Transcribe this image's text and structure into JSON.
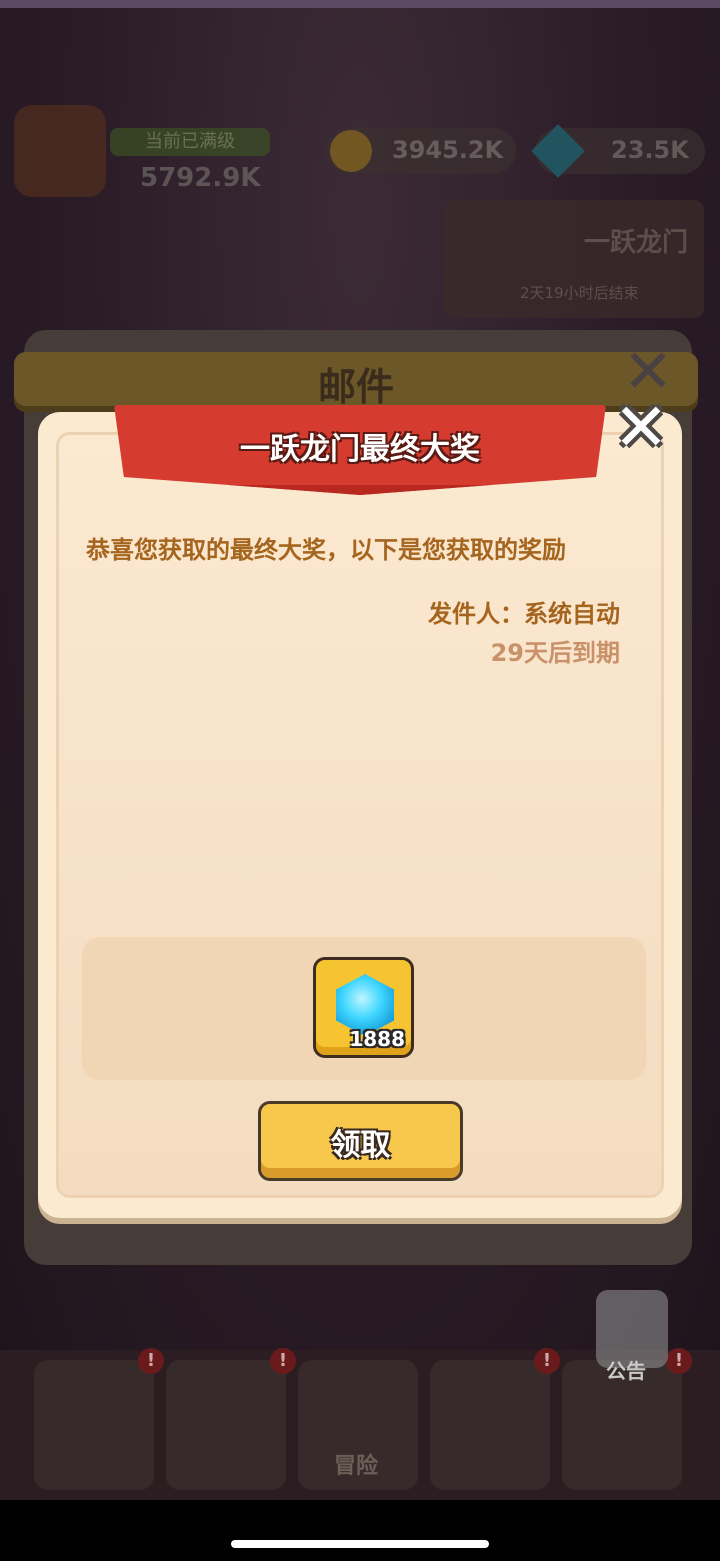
{
  "background": {
    "hud": {
      "level_text": "当前已满级",
      "power": "5792.9K",
      "gold": "3945.2K",
      "gems": "23.5K"
    },
    "event_card": {
      "title": "一跃龙门",
      "subtitle": "2天19小时后结束"
    },
    "mail_window": {
      "title": "邮件"
    },
    "bottom_nav": {
      "adventure_label": "冒险",
      "notice_label": "公告"
    }
  },
  "dialog": {
    "title": "一跃龙门最终大奖",
    "message": "恭喜您获取的最终大奖，以下是您获取的奖励",
    "sender": "发件人：系统自动",
    "expiry": "29天后到期",
    "reward": {
      "icon": "blue-gem-icon",
      "count": "1888"
    },
    "claim_button": "领取"
  },
  "colors": {
    "ribbon": "#d63b30",
    "dialog_bg": "#fbe9d0",
    "text_brown": "#a5651e",
    "button_yellow": "#f7c84b"
  }
}
